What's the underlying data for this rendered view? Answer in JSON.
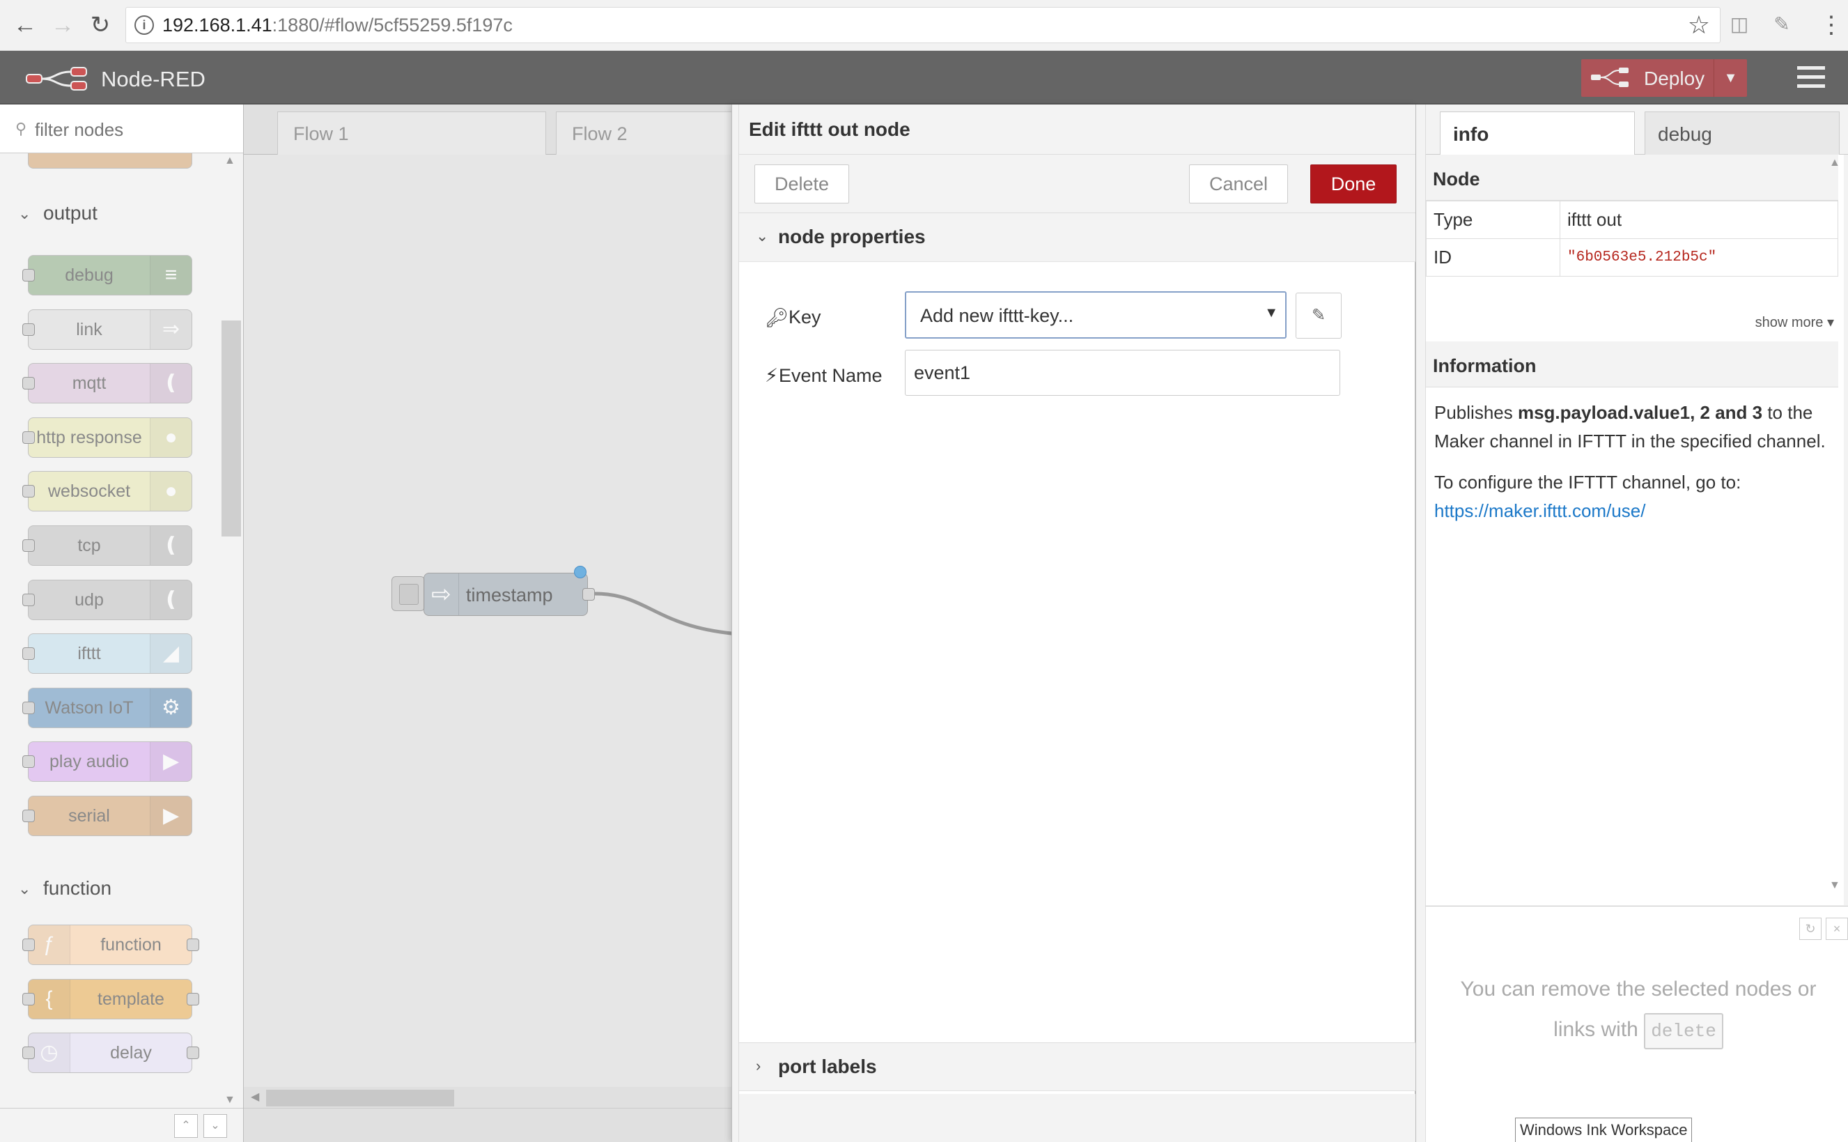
{
  "browser": {
    "url_host": "192.168.1.41",
    "url_rest": ":1880/#flow/5cf55259.5f197c"
  },
  "app": {
    "title": "Node-RED",
    "deploy_label": "Deploy"
  },
  "palette": {
    "search_placeholder": "filter nodes",
    "categories": {
      "output": "output",
      "function": "function"
    },
    "output_nodes": [
      {
        "label": "debug",
        "color": "#87a980"
      },
      {
        "label": "link",
        "color": "#dddddd"
      },
      {
        "label": "mqtt",
        "color": "#d8bfd8"
      },
      {
        "label": "http response",
        "color": "#e7e7ae"
      },
      {
        "label": "websocket",
        "color": "#e7e7ae"
      },
      {
        "label": "tcp",
        "color": "#c0c0c0"
      },
      {
        "label": "udp",
        "color": "#c0c0c0"
      },
      {
        "label": "ifttt",
        "color": "#c0deed"
      },
      {
        "label": "Watson IoT",
        "color": "#5b8fbc"
      },
      {
        "label": "play audio",
        "color": "#d7a6f0"
      },
      {
        "label": "serial",
        "color": "#d4a06a"
      }
    ],
    "function_nodes": [
      {
        "label": "function",
        "color": "#fdd0a2"
      },
      {
        "label": "template",
        "color": "#e9a948"
      },
      {
        "label": "delay",
        "color": "#e6e0f8"
      }
    ]
  },
  "workspace": {
    "tabs": [
      "Flow 1",
      "Flow 2"
    ],
    "node_label": "timestamp"
  },
  "tray": {
    "title": "Edit ifttt out node",
    "delete_label": "Delete",
    "cancel_label": "Cancel",
    "done_label": "Done",
    "properties_label": "node properties",
    "key_label": "Key",
    "key_value": "Add new ifttt-key...",
    "event_label": "Event Name",
    "event_value": "event1",
    "port_labels_label": "port labels"
  },
  "sidebar": {
    "tab_info": "info",
    "tab_debug": "debug",
    "node_section": "Node",
    "type_key": "Type",
    "type_value": "ifttt out",
    "id_key": "ID",
    "id_value": "\"6b0563e5.212b5c\"",
    "show_more": "show more",
    "information_section": "Information",
    "info_text_1": "Publishes ",
    "info_bold": "msg.payload.value1, 2 and 3",
    "info_text_2": " to the Maker channel in IFTTT in the specified channel.",
    "info_text_3": "To configure the IFTTT channel, go to:",
    "info_link": "https://maker.ifttt.com/use/",
    "help_text": "You can remove the selected nodes or links with",
    "help_kbd": "delete"
  },
  "tooltip": "Windows Ink Workspace"
}
